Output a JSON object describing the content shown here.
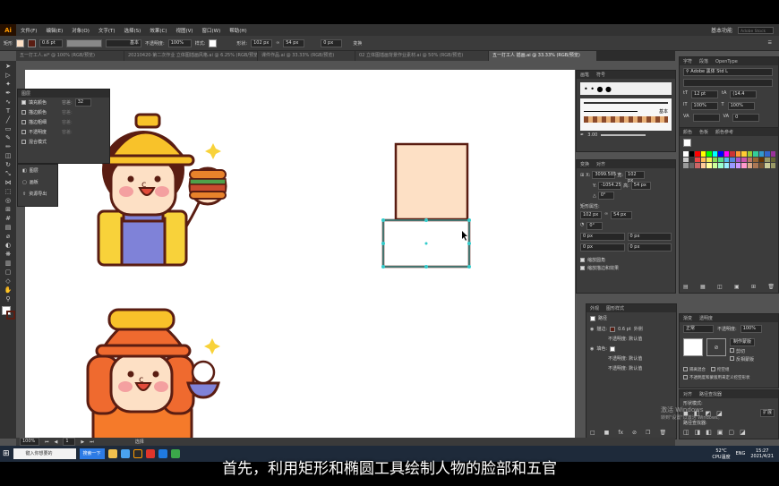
{
  "app": {
    "logo": "Ai"
  },
  "menubar": {
    "items": [
      "文件(F)",
      "编辑(E)",
      "对象(O)",
      "文字(T)",
      "选择(S)",
      "效果(C)",
      "视图(V)",
      "窗口(W)",
      "帮助(H)"
    ],
    "workspace": "基本功能",
    "search_placeholder": "Adobe Stock"
  },
  "control_bar": {
    "label": "矩形",
    "stroke_value": "0.6 pt",
    "style_label": "基本",
    "opacity_label": "不透明度:",
    "opacity_value": "100%",
    "style2_label": "样式:",
    "shape_label": "形状:",
    "width_value": "102 px",
    "height_value": "54 px",
    "corner_value": "0 px",
    "transform_label": "变换"
  },
  "doc_tabs": [
    {
      "label": "五一打工人.ai* @ 100% (RGB/预览)",
      "active": false
    },
    {
      "label": "20210420-第二次作业 立体图插画风格.ai @ 6.25% (RGB/预览)",
      "active": false
    },
    {
      "label": "课件作品.ai @ 33.33% (RGB/预览)",
      "active": false
    },
    {
      "label": "02 立体图插画背景作业素材.ai @ 50% (RGB/预览)",
      "active": false
    },
    {
      "label": "五一打工人 插画.ai @ 33.33% (RGB/预览)",
      "active": true
    }
  ],
  "layers_panel": {
    "title": "图层",
    "rows": [
      {
        "label": "填充颜色",
        "extra": "容差:",
        "value": "32"
      },
      {
        "label": "描边颜色",
        "extra": "容差:",
        "value": ""
      },
      {
        "label": "描边粗细",
        "extra": "容差:",
        "value": ""
      },
      {
        "label": "不透明度",
        "extra": "容差:",
        "value": ""
      },
      {
        "label": "混合模式",
        "extra": "",
        "value": ""
      }
    ]
  },
  "mini_panel": {
    "items": [
      "图层",
      "画板",
      "资源导出"
    ]
  },
  "right_panels": {
    "brushes_tab": "画笔",
    "symbols_tab": "符号",
    "brush_label": "基本",
    "brush_size": "3.00",
    "char_tabs": [
      "字符",
      "段落",
      "OpenType"
    ],
    "font_name": "Adobe 黑体 Std L",
    "font_size": "12 pt",
    "leading": "(14.4",
    "scale_h": "100%",
    "scale_v": "100%",
    "tracking": "0",
    "color_tabs": [
      "颜色",
      "色板",
      "颜色参考"
    ],
    "transform_tabs": [
      "变换",
      "对齐"
    ],
    "x_value": "3099.585",
    "y_value": "-1054.25",
    "w_value": "102 px",
    "h_value": "54 px",
    "rotate_value": "0°",
    "rect_props_label": "矩形属性:",
    "rect_w": "102 px",
    "rect_h": "54 px",
    "rect_angle": "0°",
    "radius_values": [
      "0 px",
      "0 px",
      "0 px",
      "0 px"
    ],
    "check1": "缩放圆角",
    "check2": "缩放描边和效果",
    "appearance_tabs": [
      "外观",
      "图形样式"
    ],
    "appearance_title": "路径",
    "stroke_label": "描边:",
    "stroke_value": "0.6 pt",
    "stroke_extra": "外侧",
    "opacity_default": "不透明度: 默认值",
    "fill_label": "填色:",
    "opacity_default2": "不透明度: 默认值",
    "opacity_default3": "不透明度: 默认值",
    "transparency_tabs": [
      "渐变",
      "透明度"
    ],
    "blend_mode": "正常",
    "opacity_label": "不透明度:",
    "opacity_value": "100%",
    "make_mask": "制作蒙版",
    "clip": "剪切",
    "invert_mask": "反相蒙版",
    "iso_blend": "隔离混合",
    "knockout": "挖空组",
    "opacity_mask_text": "不透明度和蒙版用来定义挖空形状",
    "pathfinder_tabs": [
      "对齐",
      "路径查找器"
    ],
    "shape_modes": "形状模式:",
    "expand": "扩展",
    "pathfinder_label": "路径查找器:"
  },
  "status_bar": {
    "zoom": "100%",
    "page": "1",
    "mode": "选择"
  },
  "taskbar": {
    "search_placeholder": "键入你想要的",
    "search_btn": "搜索一下",
    "temp": "52°C",
    "cpu": "CPU温度",
    "lang": "ENG",
    "time": "15:27",
    "date": "2021/4/21"
  },
  "watermark": {
    "line1": "激活 Windows",
    "line2": "转到\"设置\"以激活 Windows。"
  },
  "subtitle": "首先，利用矩形和椭圆工具绘制人物的脸部和五官",
  "colors": {
    "accent": "#ff9a00",
    "skin": "#fde0c5",
    "outline": "#5a1d12",
    "selection": "#33cccc"
  }
}
